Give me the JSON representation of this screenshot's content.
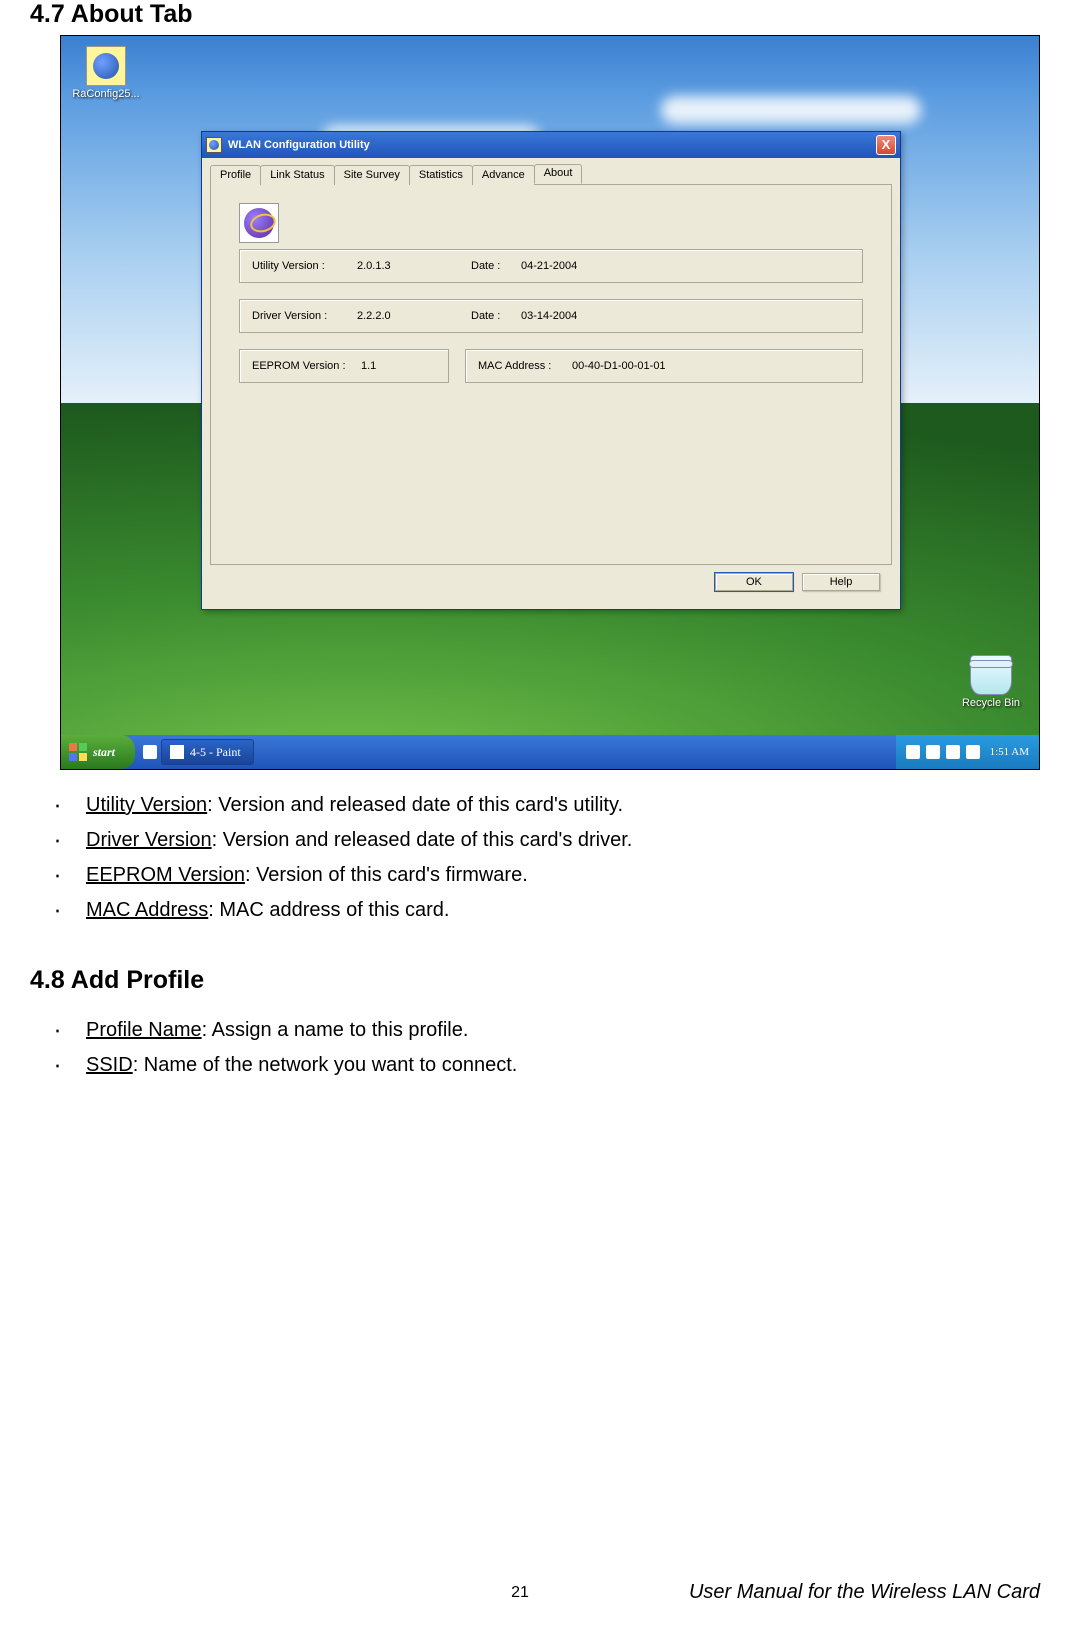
{
  "doc": {
    "heading_47": "4.7 About Tab",
    "heading_48": "4.8 Add Profile",
    "bullets_47": [
      {
        "term": "Utility Version",
        "desc": ": Version and released date of this card's utility."
      },
      {
        "term": "Driver Version",
        "desc": ": Version and released date of this card's driver."
      },
      {
        "term": "EEPROM Version",
        "desc": ": Version of this card's firmware."
      },
      {
        "term": "MAC Address",
        "desc": ": MAC address of this card."
      }
    ],
    "bullets_48": [
      {
        "term": "Profile Name",
        "desc": ": Assign a name to this profile."
      },
      {
        "term": "SSID",
        "desc": ": Name of the network you want to connect."
      }
    ],
    "page_number": "21",
    "footer_text": "User Manual for the Wireless LAN Card"
  },
  "desktop": {
    "icon_label": "RaConfig25...",
    "recycle_label": "Recycle Bin"
  },
  "window": {
    "title": "WLAN Configuration Utility",
    "tabs": [
      "Profile",
      "Link Status",
      "Site Survey",
      "Statistics",
      "Advance",
      "About"
    ],
    "active_tab_index": 5,
    "fields": {
      "utility_label": "Utility Version :",
      "utility_value": "2.0.1.3",
      "utility_date_label": "Date :",
      "utility_date_value": "04-21-2004",
      "driver_label": "Driver Version :",
      "driver_value": "2.2.2.0",
      "driver_date_label": "Date :",
      "driver_date_value": "03-14-2004",
      "eeprom_label": "EEPROM Version :",
      "eeprom_value": "1.1",
      "mac_label": "MAC Address :",
      "mac_value": "00-40-D1-00-01-01"
    },
    "buttons": {
      "ok": "OK",
      "help": "Help"
    }
  },
  "taskbar": {
    "start": "start",
    "task_item": "4-5 - Paint",
    "clock": "1:51 AM"
  }
}
